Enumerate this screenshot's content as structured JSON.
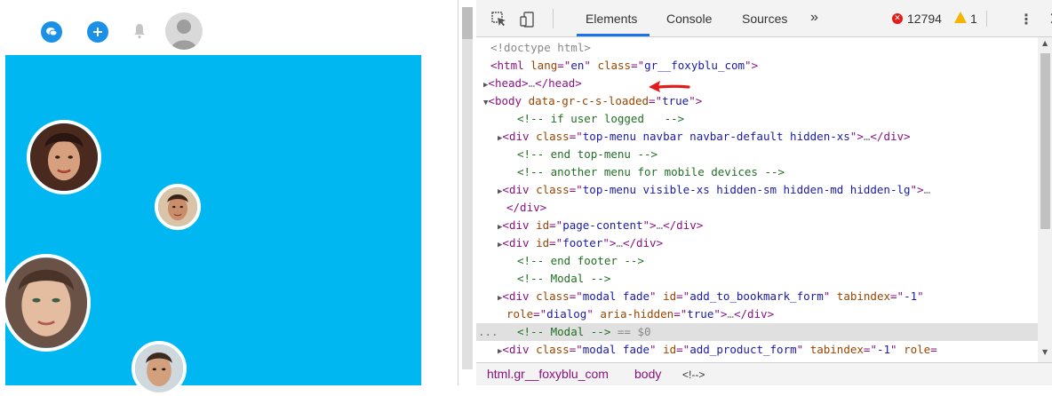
{
  "colors": {
    "accent": "#00b7f1",
    "icon_blue": "#1a90e6",
    "tab_underline": "#1a73e8",
    "error": "#e21b1b",
    "warning": "#f4b400",
    "annotation_arrow": "#e21b1b"
  },
  "page": {
    "topbar_icons": [
      "chat-icon",
      "plus-icon",
      "bell-icon",
      "avatar"
    ],
    "faces": [
      "face-woman-1",
      "face-man-1",
      "face-woman-2",
      "face-man-2"
    ]
  },
  "devtools": {
    "tabs": [
      "Elements",
      "Console",
      "Sources"
    ],
    "active_tab": "Elements",
    "more_tabs": "»",
    "error_count": "12794",
    "warning_count": "1",
    "close": "✕",
    "menu": "⋮",
    "dom_lines": [
      {
        "parts": [
          {
            "c": "gray",
            "t": "<!doctype html>"
          }
        ]
      },
      {
        "parts": [
          {
            "c": "tag",
            "t": "<html "
          },
          {
            "c": "attr",
            "t": "lang"
          },
          {
            "c": "tag",
            "t": "=\""
          },
          {
            "c": "val",
            "t": "en"
          },
          {
            "c": "tag",
            "t": "\" "
          },
          {
            "c": "attr",
            "t": "class"
          },
          {
            "c": "tag",
            "t": "=\""
          },
          {
            "c": "val",
            "t": "gr__foxyblu_com"
          },
          {
            "c": "tag",
            "t": "\">"
          }
        ]
      },
      {
        "parts": [
          {
            "c": "tag",
            "t": "<head>"
          },
          {
            "c": "ellip",
            "t": "…"
          },
          {
            "c": "tag",
            "t": "</head>"
          }
        ]
      },
      {
        "parts": [
          {
            "c": "tag",
            "t": "<body "
          },
          {
            "c": "attr",
            "t": "data-gr-c-s-loaded"
          },
          {
            "c": "tag",
            "t": "=\""
          },
          {
            "c": "val",
            "t": "true"
          },
          {
            "c": "tag",
            "t": "\">"
          }
        ]
      },
      {
        "parts": [
          {
            "c": "cmt",
            "t": "<!-- if user logged   -->"
          }
        ]
      },
      {
        "parts": [
          {
            "c": "tag",
            "t": "<div "
          },
          {
            "c": "attr",
            "t": "class"
          },
          {
            "c": "tag",
            "t": "=\""
          },
          {
            "c": "val",
            "t": "top-menu navbar navbar-default hidden-xs"
          },
          {
            "c": "tag",
            "t": "\">"
          },
          {
            "c": "ellip",
            "t": "…"
          },
          {
            "c": "tag",
            "t": "</div>"
          }
        ]
      },
      {
        "parts": [
          {
            "c": "cmt",
            "t": "<!-- end top-menu -->"
          }
        ]
      },
      {
        "parts": [
          {
            "c": "cmt",
            "t": "<!-- another menu for mobile devices -->"
          }
        ]
      },
      {
        "parts": [
          {
            "c": "tag",
            "t": "<div "
          },
          {
            "c": "attr",
            "t": "class"
          },
          {
            "c": "tag",
            "t": "=\""
          },
          {
            "c": "val",
            "t": "top-menu visible-xs hidden-sm hidden-md hidden-lg"
          },
          {
            "c": "tag",
            "t": "\">"
          },
          {
            "c": "ellip",
            "t": "…"
          }
        ]
      },
      {
        "parts": [
          {
            "c": "tag",
            "t": "</div>"
          }
        ]
      },
      {
        "parts": [
          {
            "c": "tag",
            "t": "<div "
          },
          {
            "c": "attr",
            "t": "id"
          },
          {
            "c": "tag",
            "t": "=\""
          },
          {
            "c": "val",
            "t": "page-content"
          },
          {
            "c": "tag",
            "t": "\">"
          },
          {
            "c": "ellip",
            "t": "…"
          },
          {
            "c": "tag",
            "t": "</div>"
          }
        ]
      },
      {
        "parts": [
          {
            "c": "tag",
            "t": "<div "
          },
          {
            "c": "attr",
            "t": "id"
          },
          {
            "c": "tag",
            "t": "=\""
          },
          {
            "c": "val",
            "t": "footer"
          },
          {
            "c": "tag",
            "t": "\">"
          },
          {
            "c": "ellip",
            "t": "…"
          },
          {
            "c": "tag",
            "t": "</div>"
          }
        ]
      },
      {
        "parts": [
          {
            "c": "cmt",
            "t": "<!-- end footer -->"
          }
        ]
      },
      {
        "parts": [
          {
            "c": "cmt",
            "t": "<!-- Modal -->"
          }
        ]
      },
      {
        "parts": [
          {
            "c": "tag",
            "t": "<div "
          },
          {
            "c": "attr",
            "t": "class"
          },
          {
            "c": "tag",
            "t": "=\""
          },
          {
            "c": "val",
            "t": "modal fade"
          },
          {
            "c": "tag",
            "t": "\" "
          },
          {
            "c": "attr",
            "t": "id"
          },
          {
            "c": "tag",
            "t": "=\""
          },
          {
            "c": "val",
            "t": "add_to_bookmark_form"
          },
          {
            "c": "tag",
            "t": "\" "
          },
          {
            "c": "attr",
            "t": "tabindex"
          },
          {
            "c": "tag",
            "t": "=\""
          },
          {
            "c": "val",
            "t": "-1"
          },
          {
            "c": "tag",
            "t": "\""
          }
        ]
      },
      {
        "parts": [
          {
            "c": "attr",
            "t": "role"
          },
          {
            "c": "tag",
            "t": "=\""
          },
          {
            "c": "val",
            "t": "dialog"
          },
          {
            "c": "tag",
            "t": "\" "
          },
          {
            "c": "attr",
            "t": "aria-hidden"
          },
          {
            "c": "tag",
            "t": "=\""
          },
          {
            "c": "val",
            "t": "true"
          },
          {
            "c": "tag",
            "t": "\">"
          },
          {
            "c": "ellip",
            "t": "…"
          },
          {
            "c": "tag",
            "t": "</div>"
          }
        ]
      },
      {
        "parts": [
          {
            "c": "cmt",
            "t": "<!-- Modal -->"
          },
          {
            "c": "gray",
            "t": " == $0"
          }
        ]
      },
      {
        "parts": [
          {
            "c": "tag",
            "t": "<div "
          },
          {
            "c": "attr",
            "t": "class"
          },
          {
            "c": "tag",
            "t": "=\""
          },
          {
            "c": "val",
            "t": "modal fade"
          },
          {
            "c": "tag",
            "t": "\" "
          },
          {
            "c": "attr",
            "t": "id"
          },
          {
            "c": "tag",
            "t": "=\""
          },
          {
            "c": "val",
            "t": "add_product_form"
          },
          {
            "c": "tag",
            "t": "\" "
          },
          {
            "c": "attr",
            "t": "tabindex"
          },
          {
            "c": "tag",
            "t": "=\""
          },
          {
            "c": "val",
            "t": "-1"
          },
          {
            "c": "tag",
            "t": "\" "
          },
          {
            "c": "attr",
            "t": "role"
          },
          {
            "c": "tag",
            "t": "="
          }
        ]
      }
    ],
    "selected_line_marker": "...",
    "breadcrumbs": [
      "html.gr__foxyblu_com",
      "body",
      "<!-->"
    ]
  }
}
